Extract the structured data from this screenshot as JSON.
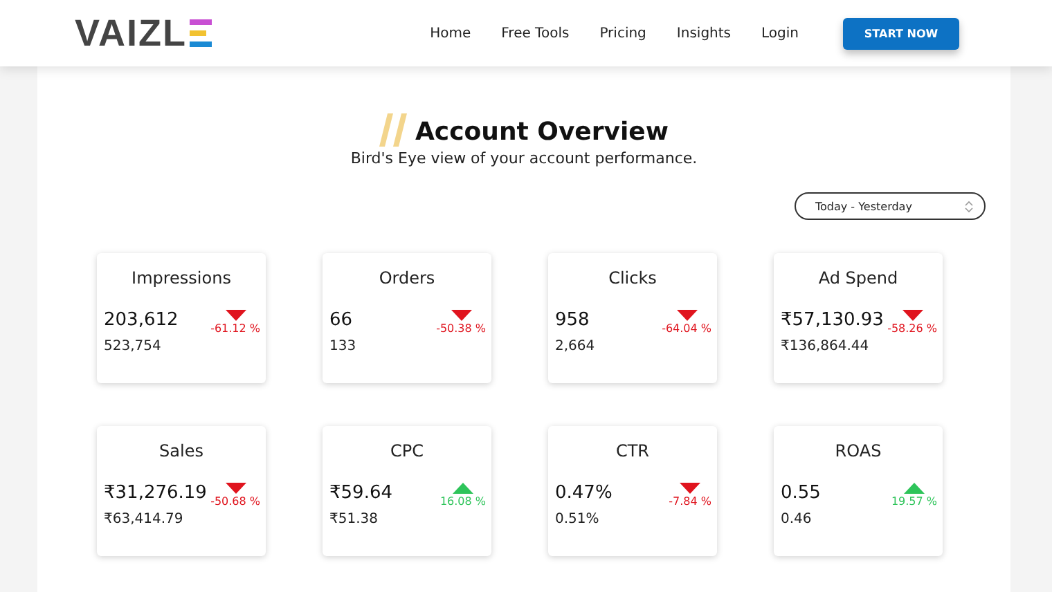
{
  "header": {
    "logo": "VAIZL",
    "nav": [
      {
        "label": "Home"
      },
      {
        "label": "Free Tools"
      },
      {
        "label": "Pricing"
      },
      {
        "label": "Insights"
      },
      {
        "label": "Login"
      }
    ],
    "cta": "START NOW"
  },
  "title": "Account Overview",
  "subtitle": "Bird's Eye view of your account performance.",
  "date_range": "Today - Yesterday",
  "cards": [
    {
      "title": "Impressions",
      "value": "203,612",
      "previous": "523,754",
      "change": "-61.12 %",
      "kind": "down"
    },
    {
      "title": "Orders",
      "value": "66",
      "previous": "133",
      "change": "-50.38 %",
      "kind": "down"
    },
    {
      "title": "Clicks",
      "value": "958",
      "previous": "2,664",
      "change": "-64.04 %",
      "kind": "down"
    },
    {
      "title": "Ad Spend",
      "value": "₹57,130.93",
      "previous": "₹136,864.44",
      "change": "-58.26 %",
      "kind": "down"
    },
    {
      "title": "Sales",
      "value": "₹31,276.19",
      "previous": "₹63,414.79",
      "change": "-50.68 %",
      "kind": "down"
    },
    {
      "title": "CPC",
      "value": "₹59.64",
      "previous": "₹51.38",
      "change": "16.08 %",
      "kind": "up"
    },
    {
      "title": "CTR",
      "value": "0.47%",
      "previous": "0.51%",
      "change": "-7.84 %",
      "kind": "down"
    },
    {
      "title": "ROAS",
      "value": "0.55",
      "previous": "0.46",
      "change": "19.57 %",
      "kind": "up"
    }
  ]
}
